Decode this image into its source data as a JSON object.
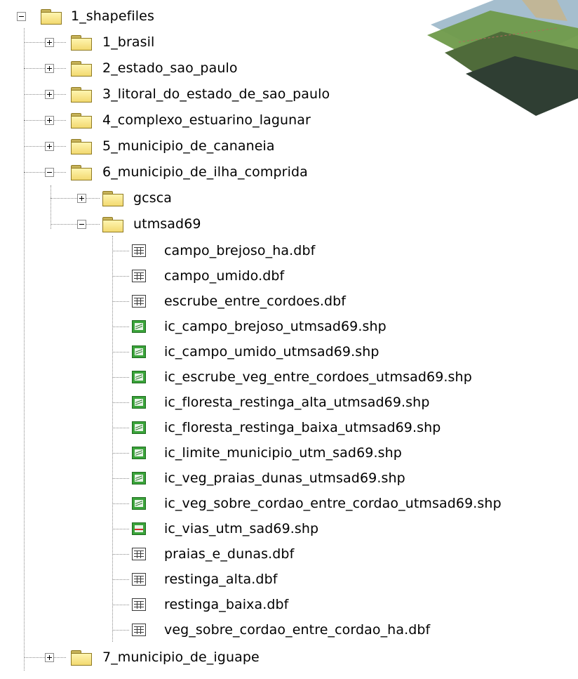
{
  "colors": {
    "folder": "#f2d970",
    "shapefile": "#3aa33a",
    "line_feature": "#d42a2a",
    "tree_lines": "#8a8a8a"
  },
  "tree": {
    "root": {
      "label": "1_shapefiles",
      "expanded": true,
      "icon": "folder-icon"
    },
    "level1": [
      {
        "label": "1_brasil",
        "expanded": false,
        "icon": "folder-icon"
      },
      {
        "label": "2_estado_sao_paulo",
        "expanded": false,
        "icon": "folder-icon"
      },
      {
        "label": "3_litoral_do_estado_de_sao_paulo",
        "expanded": false,
        "icon": "folder-icon"
      },
      {
        "label": "4_complexo_estuarino_lagunar",
        "expanded": false,
        "icon": "folder-icon"
      },
      {
        "label": "5_municipio_de_cananeia",
        "expanded": false,
        "icon": "folder-icon"
      },
      {
        "label": "6_municipio_de_ilha_comprida",
        "expanded": true,
        "icon": "folder-icon"
      },
      {
        "label": "7_municipio_de_iguape",
        "expanded": false,
        "icon": "folder-icon"
      }
    ],
    "level2": [
      {
        "label": "gcsca",
        "expanded": false,
        "icon": "folder-icon"
      },
      {
        "label": "utmsad69",
        "expanded": true,
        "icon": "folder-icon"
      }
    ],
    "files": [
      {
        "label": "campo_brejoso_ha.dbf",
        "icon": "table-icon"
      },
      {
        "label": "campo_umido.dbf",
        "icon": "table-icon"
      },
      {
        "label": "escrube_entre_cordoes.dbf",
        "icon": "table-icon"
      },
      {
        "label": "ic_campo_brejoso_utmsad69.shp",
        "icon": "polygon-shapefile-icon"
      },
      {
        "label": "ic_campo_umido_utmsad69.shp",
        "icon": "polygon-shapefile-icon"
      },
      {
        "label": "ic_escrube_veg_entre_cordoes_utmsad69.shp",
        "icon": "polygon-shapefile-icon"
      },
      {
        "label": "ic_floresta_restinga_alta_utmsad69.shp",
        "icon": "polygon-shapefile-icon"
      },
      {
        "label": "ic_floresta_restinga_baixa_utmsad69.shp",
        "icon": "polygon-shapefile-icon"
      },
      {
        "label": "ic_limite_municipio_utm_sad69.shp",
        "icon": "polygon-shapefile-icon"
      },
      {
        "label": "ic_veg_praias_dunas_utmsad69.shp",
        "icon": "polygon-shapefile-icon"
      },
      {
        "label": "ic_veg_sobre_cordao_entre_cordao_utmsad69.shp",
        "icon": "polygon-shapefile-icon"
      },
      {
        "label": "ic_vias_utm_sad69.shp",
        "icon": "line-shapefile-icon"
      },
      {
        "label": "praias_e_dunas.dbf",
        "icon": "table-icon"
      },
      {
        "label": "restinga_alta.dbf",
        "icon": "table-icon"
      },
      {
        "label": "restinga_baixa.dbf",
        "icon": "table-icon"
      },
      {
        "label": "veg_sobre_cordao_entre_cordao_ha.dbf",
        "icon": "table-icon"
      }
    ]
  }
}
